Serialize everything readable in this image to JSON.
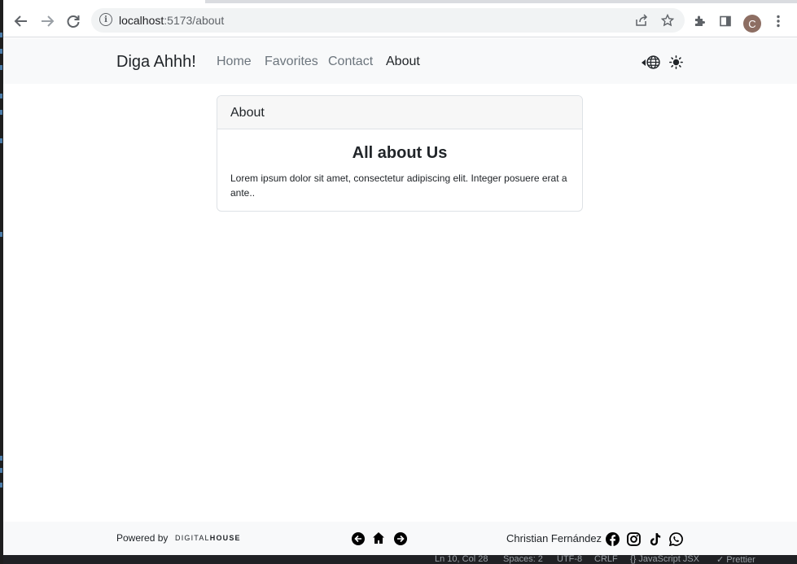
{
  "browser": {
    "url_host": "localhost",
    "url_rest": ":5173/about",
    "avatar_letter": "C"
  },
  "navbar": {
    "brand": "Diga Ahhh!",
    "links": [
      {
        "label": "Home",
        "active": false
      },
      {
        "label": "Favorites",
        "active": false
      },
      {
        "label": "Contact",
        "active": false
      },
      {
        "label": "About",
        "active": true
      }
    ]
  },
  "card": {
    "header": "About",
    "title": "All about Us",
    "text": "Lorem ipsum dolor sit amet, consectetur adipiscing elit. Integer posuere erat a ante.."
  },
  "footer": {
    "powered_by": "Powered by",
    "logo_light": "DIGITAL",
    "logo_bold": "HOUSE",
    "author": "Christian Fernández"
  },
  "statusbar": {
    "items": [
      "Ln 10, Col 28",
      "Spaces: 2",
      "UTF-8",
      "CRLF",
      "{} JavaScript JSX",
      "✓ Prettier"
    ]
  },
  "colors": {
    "navbar_bg": "#f8f9fa",
    "text": "#212529",
    "muted": "#6c757d",
    "avatar": "#8d6e63"
  }
}
